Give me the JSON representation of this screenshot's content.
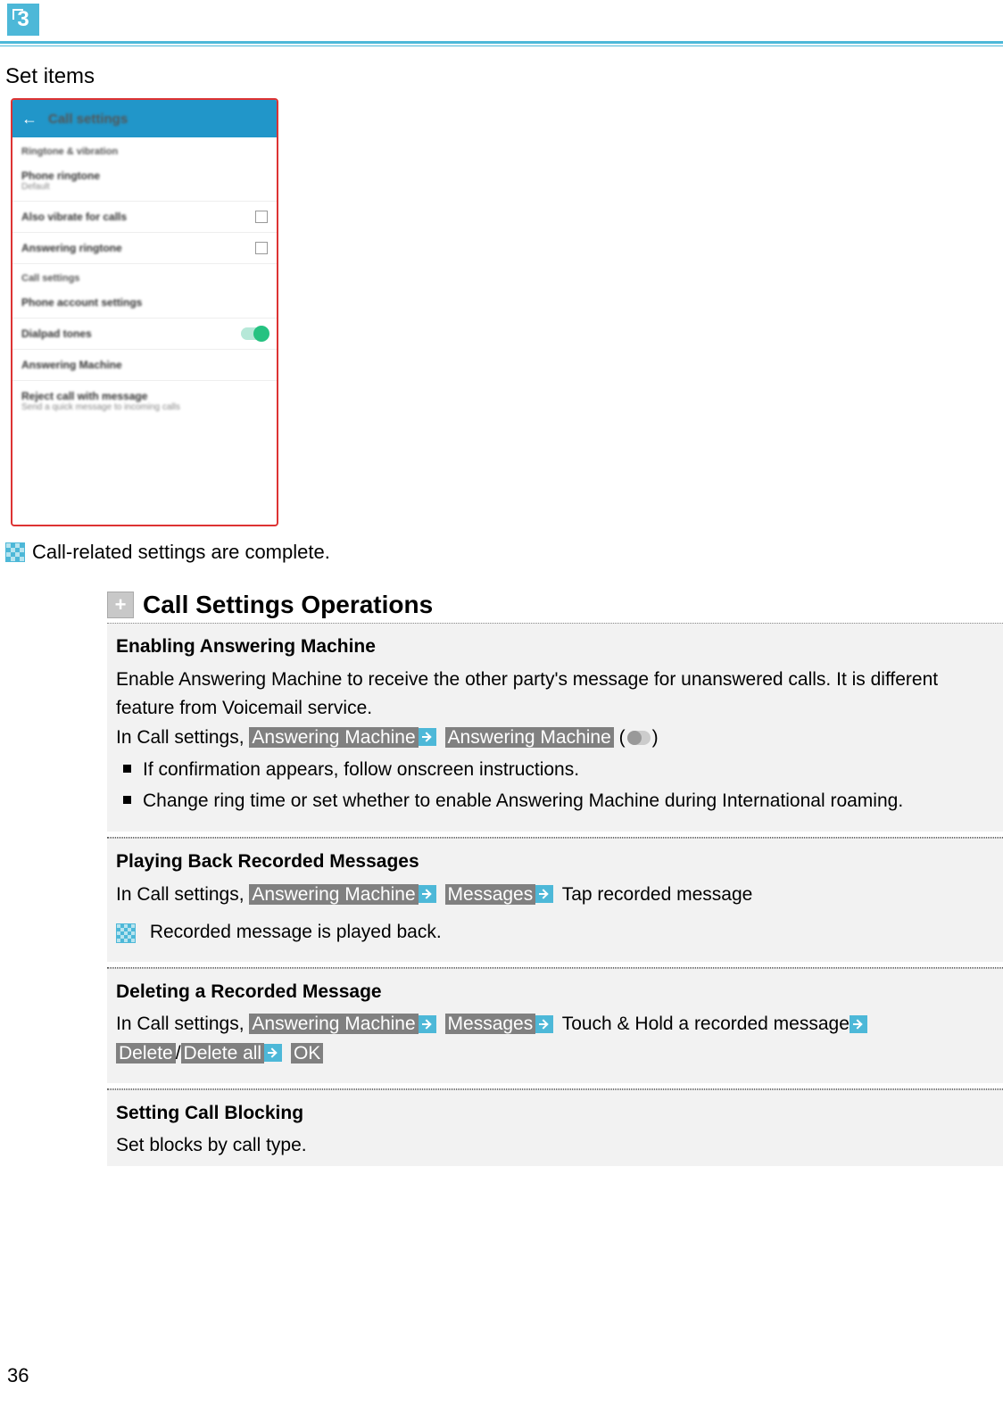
{
  "step_number": "3",
  "set_items_label": "Set items",
  "phone": {
    "header": "Call settings",
    "section1": "Ringtone & vibration",
    "item_ringtone_label": "Phone ringtone",
    "item_ringtone_sub": "Default",
    "item_vibrate": "Also vibrate for calls",
    "item_ringtone2": "Answering ringtone",
    "section2": "Call settings",
    "item_account": "Phone account settings",
    "item_dialpad": "Dialpad tones",
    "item_answering": "Answering Machine",
    "item_reject_label": "Reject call with message",
    "item_reject_sub": "Send a quick message to incoming calls"
  },
  "complete_text": "Call-related settings are complete.",
  "ops_title": "Call Settings Operations",
  "op1": {
    "heading": "Enabling Answering Machine",
    "desc": "Enable Answering Machine to receive the other party's message for unanswered calls. It is different feature from Voicemail service.",
    "prefix": "In Call settings, ",
    "chip1": "Answering Machine",
    "chip2": "Answering Machine",
    "paren_open": " (",
    "paren_close": ")",
    "bullet1": "If confirmation appears, follow onscreen instructions.",
    "bullet2": "Change ring time or set whether to enable Answering Machine during International roaming."
  },
  "op2": {
    "heading": "Playing Back Recorded Messages",
    "prefix": "In Call settings, ",
    "chip1": "Answering Machine",
    "chip2": "Messages",
    "tail": " Tap recorded message",
    "result": " Recorded message is played back."
  },
  "op3": {
    "heading": "Deleting a Recorded Message",
    "prefix": "In Call settings, ",
    "chip1": "Answering Machine",
    "chip2": "Messages",
    "mid": " Touch & Hold a recorded message",
    "chip3": "Delete",
    "slash": "/",
    "chip4": "Delete all",
    "chip5": "OK"
  },
  "op4": {
    "heading": "Setting Call Blocking",
    "desc": "Set blocks by call type."
  },
  "page_number": "36"
}
